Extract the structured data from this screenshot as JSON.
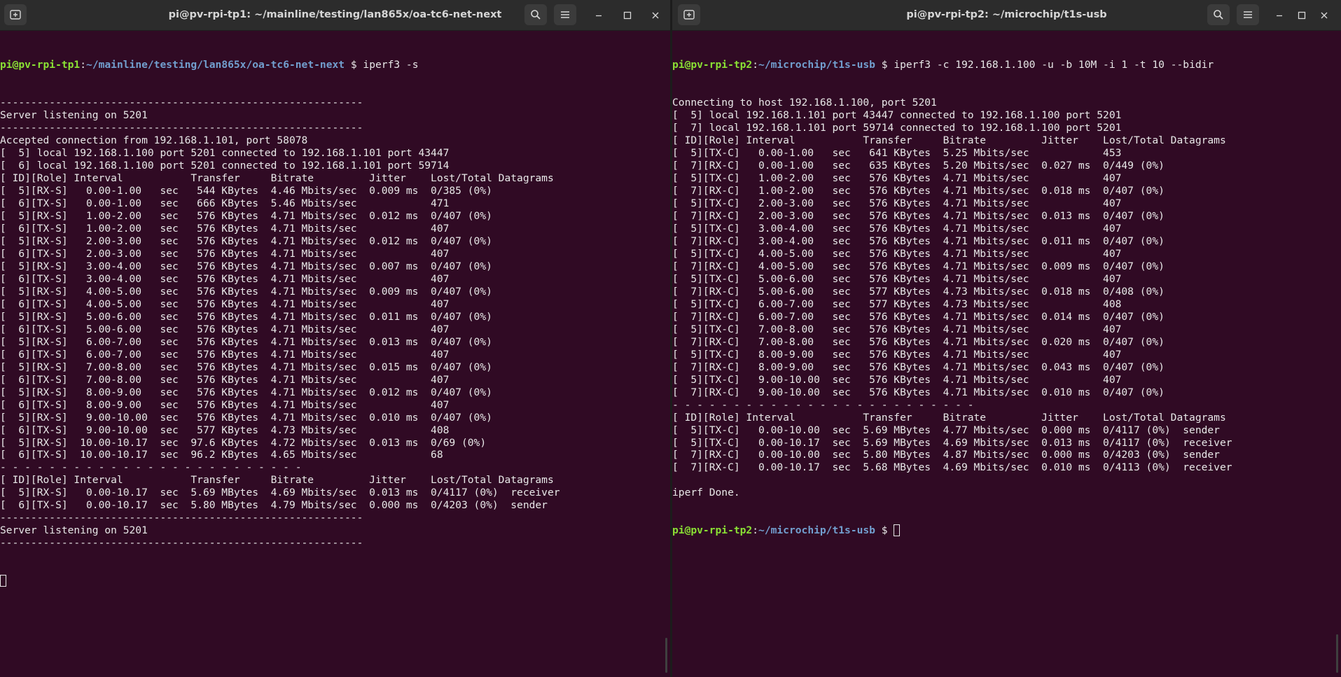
{
  "left": {
    "title": "pi@pv-rpi-tp1: ~/mainline/testing/lan865x/oa-tc6-net-next",
    "prompt": {
      "user_host": "pi@pv-rpi-tp1",
      "sep": ":",
      "path": "~/mainline/testing/lan865x/oa-tc6-net-next",
      "symbol": " $ ",
      "command": "iperf3 -s"
    },
    "lines": [
      "-----------------------------------------------------------",
      "Server listening on 5201",
      "-----------------------------------------------------------",
      "Accepted connection from 192.168.1.101, port 58078",
      "[  5] local 192.168.1.100 port 5201 connected to 192.168.1.101 port 43447",
      "[  6] local 192.168.1.100 port 5201 connected to 192.168.1.101 port 59714",
      "[ ID][Role] Interval           Transfer     Bitrate         Jitter    Lost/Total Datagrams",
      "[  5][RX-S]   0.00-1.00   sec   544 KBytes  4.46 Mbits/sec  0.009 ms  0/385 (0%)",
      "[  6][TX-S]   0.00-1.00   sec   666 KBytes  5.46 Mbits/sec            471",
      "[  5][RX-S]   1.00-2.00   sec   576 KBytes  4.71 Mbits/sec  0.012 ms  0/407 (0%)",
      "[  6][TX-S]   1.00-2.00   sec   576 KBytes  4.71 Mbits/sec            407",
      "[  5][RX-S]   2.00-3.00   sec   576 KBytes  4.71 Mbits/sec  0.012 ms  0/407 (0%)",
      "[  6][TX-S]   2.00-3.00   sec   576 KBytes  4.71 Mbits/sec            407",
      "[  5][RX-S]   3.00-4.00   sec   576 KBytes  4.71 Mbits/sec  0.007 ms  0/407 (0%)",
      "[  6][TX-S]   3.00-4.00   sec   576 KBytes  4.71 Mbits/sec            407",
      "[  5][RX-S]   4.00-5.00   sec   576 KBytes  4.71 Mbits/sec  0.009 ms  0/407 (0%)",
      "[  6][TX-S]   4.00-5.00   sec   576 KBytes  4.71 Mbits/sec            407",
      "[  5][RX-S]   5.00-6.00   sec   576 KBytes  4.71 Mbits/sec  0.011 ms  0/407 (0%)",
      "[  6][TX-S]   5.00-6.00   sec   576 KBytes  4.71 Mbits/sec            407",
      "[  5][RX-S]   6.00-7.00   sec   576 KBytes  4.71 Mbits/sec  0.013 ms  0/407 (0%)",
      "[  6][TX-S]   6.00-7.00   sec   576 KBytes  4.71 Mbits/sec            407",
      "[  5][RX-S]   7.00-8.00   sec   576 KBytes  4.71 Mbits/sec  0.015 ms  0/407 (0%)",
      "[  6][TX-S]   7.00-8.00   sec   576 KBytes  4.71 Mbits/sec            407",
      "[  5][RX-S]   8.00-9.00   sec   576 KBytes  4.71 Mbits/sec  0.012 ms  0/407 (0%)",
      "[  6][TX-S]   8.00-9.00   sec   576 KBytes  4.71 Mbits/sec            407",
      "[  5][RX-S]   9.00-10.00  sec   576 KBytes  4.71 Mbits/sec  0.010 ms  0/407 (0%)",
      "[  6][TX-S]   9.00-10.00  sec   577 KBytes  4.73 Mbits/sec            408",
      "[  5][RX-S]  10.00-10.17  sec  97.6 KBytes  4.72 Mbits/sec  0.013 ms  0/69 (0%)",
      "[  6][TX-S]  10.00-10.17  sec  96.2 KBytes  4.65 Mbits/sec            68",
      "- - - - - - - - - - - - - - - - - - - - - - - - -",
      "[ ID][Role] Interval           Transfer     Bitrate         Jitter    Lost/Total Datagrams",
      "[  5][RX-S]   0.00-10.17  sec  5.69 MBytes  4.69 Mbits/sec  0.013 ms  0/4117 (0%)  receiver",
      "[  6][TX-S]   0.00-10.17  sec  5.80 MBytes  4.79 Mbits/sec  0.000 ms  0/4203 (0%)  sender",
      "-----------------------------------------------------------",
      "Server listening on 5201",
      "-----------------------------------------------------------"
    ]
  },
  "right": {
    "title": "pi@pv-rpi-tp2: ~/microchip/t1s-usb",
    "prompt": {
      "user_host": "pi@pv-rpi-tp2",
      "sep": ":",
      "path": "~/microchip/t1s-usb",
      "symbol": " $ ",
      "command": "iperf3 -c 192.168.1.100 -u -b 10M -i 1 -t 10 --bidir"
    },
    "lines": [
      "Connecting to host 192.168.1.100, port 5201",
      "[  5] local 192.168.1.101 port 43447 connected to 192.168.1.100 port 5201",
      "[  7] local 192.168.1.101 port 59714 connected to 192.168.1.100 port 5201",
      "[ ID][Role] Interval           Transfer     Bitrate         Jitter    Lost/Total Datagrams",
      "[  5][TX-C]   0.00-1.00   sec   641 KBytes  5.25 Mbits/sec            453",
      "[  7][RX-C]   0.00-1.00   sec   635 KBytes  5.20 Mbits/sec  0.027 ms  0/449 (0%)",
      "[  5][TX-C]   1.00-2.00   sec   576 KBytes  4.71 Mbits/sec            407",
      "[  7][RX-C]   1.00-2.00   sec   576 KBytes  4.71 Mbits/sec  0.018 ms  0/407 (0%)",
      "[  5][TX-C]   2.00-3.00   sec   576 KBytes  4.71 Mbits/sec            407",
      "[  7][RX-C]   2.00-3.00   sec   576 KBytes  4.71 Mbits/sec  0.013 ms  0/407 (0%)",
      "[  5][TX-C]   3.00-4.00   sec   576 KBytes  4.71 Mbits/sec            407",
      "[  7][RX-C]   3.00-4.00   sec   576 KBytes  4.71 Mbits/sec  0.011 ms  0/407 (0%)",
      "[  5][TX-C]   4.00-5.00   sec   576 KBytes  4.71 Mbits/sec            407",
      "[  7][RX-C]   4.00-5.00   sec   576 KBytes  4.71 Mbits/sec  0.009 ms  0/407 (0%)",
      "[  5][TX-C]   5.00-6.00   sec   576 KBytes  4.71 Mbits/sec            407",
      "[  7][RX-C]   5.00-6.00   sec   577 KBytes  4.73 Mbits/sec  0.018 ms  0/408 (0%)",
      "[  5][TX-C]   6.00-7.00   sec   577 KBytes  4.73 Mbits/sec            408",
      "[  7][RX-C]   6.00-7.00   sec   576 KBytes  4.71 Mbits/sec  0.014 ms  0/407 (0%)",
      "[  5][TX-C]   7.00-8.00   sec   576 KBytes  4.71 Mbits/sec            407",
      "[  7][RX-C]   7.00-8.00   sec   576 KBytes  4.71 Mbits/sec  0.020 ms  0/407 (0%)",
      "[  5][TX-C]   8.00-9.00   sec   576 KBytes  4.71 Mbits/sec            407",
      "[  7][RX-C]   8.00-9.00   sec   576 KBytes  4.71 Mbits/sec  0.043 ms  0/407 (0%)",
      "[  5][TX-C]   9.00-10.00  sec   576 KBytes  4.71 Mbits/sec            407",
      "[  7][RX-C]   9.00-10.00  sec   576 KBytes  4.71 Mbits/sec  0.010 ms  0/407 (0%)",
      "- - - - - - - - - - - - - - - - - - - - - - - - -",
      "[ ID][Role] Interval           Transfer     Bitrate         Jitter    Lost/Total Datagrams",
      "[  5][TX-C]   0.00-10.00  sec  5.69 MBytes  4.77 Mbits/sec  0.000 ms  0/4117 (0%)  sender",
      "[  5][TX-C]   0.00-10.17  sec  5.69 MBytes  4.69 Mbits/sec  0.013 ms  0/4117 (0%)  receiver",
      "[  7][RX-C]   0.00-10.00  sec  5.80 MBytes  4.87 Mbits/sec  0.000 ms  0/4203 (0%)  sender",
      "[  7][RX-C]   0.00-10.17  sec  5.68 MBytes  4.69 Mbits/sec  0.010 ms  0/4113 (0%)  receiver",
      "",
      "iperf Done."
    ]
  },
  "colors": {
    "terminal_bg": "#300a24",
    "titlebar_bg": "#2c2c2c",
    "prompt_user": "#8ae234",
    "prompt_path": "#729fcf",
    "text": "#e8e8e8"
  },
  "icons": {
    "new_tab": "new-tab-icon",
    "search": "search-icon",
    "menu": "hamburger-menu-icon",
    "minimize": "minimize-icon",
    "maximize": "maximize-icon",
    "close": "close-icon"
  }
}
